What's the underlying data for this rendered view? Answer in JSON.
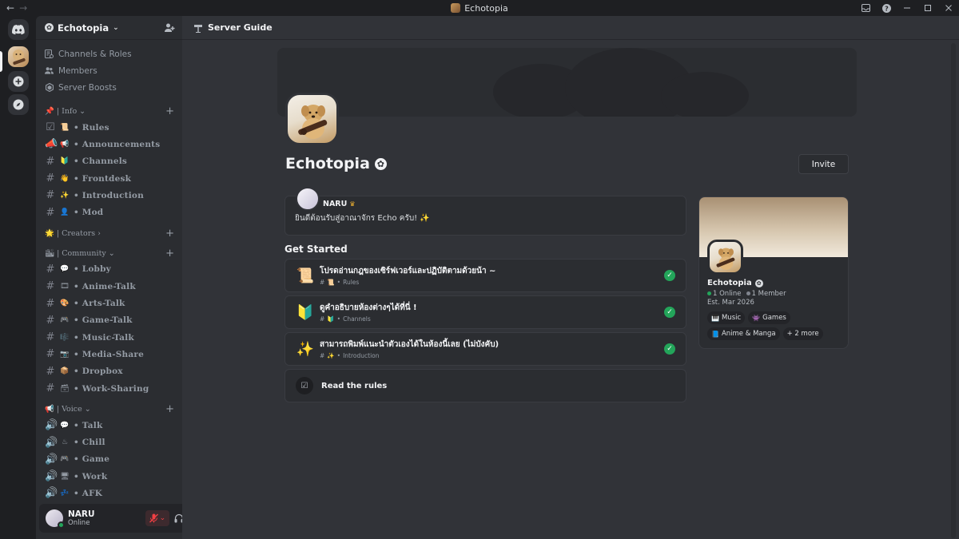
{
  "titlebar": {
    "title": "Echotopia",
    "back_icon": "←",
    "forward_icon": "→"
  },
  "sidebar": {
    "server_name": "Echotopia",
    "links": [
      {
        "label": "Channels & Roles",
        "icon": "channels-icon"
      },
      {
        "label": "Members",
        "icon": "members-icon"
      },
      {
        "label": "Server Boosts",
        "icon": "boost-icon"
      }
    ],
    "categories": [
      {
        "label": "| Info",
        "emoji": "📌",
        "expanded": true,
        "channels": [
          {
            "name": "• Rules",
            "emoji": "📜",
            "type": "rules"
          },
          {
            "name": "• Announcements",
            "emoji": "📢",
            "type": "announcement"
          },
          {
            "name": "• Channels",
            "emoji": "🔰",
            "type": "text"
          },
          {
            "name": "• Frontdesk",
            "emoji": "👋",
            "type": "text"
          },
          {
            "name": "• Introduction",
            "emoji": "✨",
            "type": "text"
          },
          {
            "name": "• Mod",
            "emoji": "👤",
            "type": "text"
          }
        ]
      },
      {
        "label": "| Creators",
        "emoji": "🌟",
        "expanded": false,
        "channels": []
      },
      {
        "label": "| Community",
        "emoji": "🏙",
        "expanded": true,
        "channels": [
          {
            "name": "• Lobby",
            "emoji": "💬",
            "type": "text"
          },
          {
            "name": "• Anime-Talk",
            "emoji": "🎞",
            "type": "text"
          },
          {
            "name": "• Arts-Talk",
            "emoji": "🎨",
            "type": "text"
          },
          {
            "name": "• Game-Talk",
            "emoji": "🎮",
            "type": "text"
          },
          {
            "name": "• Music-Talk",
            "emoji": "🎼",
            "type": "text"
          },
          {
            "name": "• Media-Share",
            "emoji": "📷",
            "type": "text"
          },
          {
            "name": "• Dropbox",
            "emoji": "📦",
            "type": "text"
          },
          {
            "name": "• Work-Sharing",
            "emoji": "🗃",
            "type": "text"
          }
        ]
      },
      {
        "label": "| Voice",
        "emoji": "📢",
        "expanded": true,
        "channels": [
          {
            "name": "• Talk",
            "emoji": "💬",
            "type": "voice"
          },
          {
            "name": "• Chill",
            "emoji": "♨",
            "type": "voice"
          },
          {
            "name": "• Game",
            "emoji": "🎮",
            "type": "voice"
          },
          {
            "name": "• Work",
            "emoji": "🖥",
            "type": "voice"
          },
          {
            "name": "• AFK",
            "emoji": "💤",
            "type": "voice"
          }
        ]
      }
    ]
  },
  "user": {
    "name": "NARU",
    "status": "Online"
  },
  "main": {
    "header_title": "Server Guide",
    "server_name": "Echotopia",
    "invite_label": "Invite",
    "welcome": {
      "author": "NARU",
      "text": "ยินดีต้อนรับสู่อาณาจักร Echo ครับ! ✨"
    },
    "get_started_title": "Get Started",
    "tasks": [
      {
        "emoji": "📜",
        "title": "โปรดอ่านกฎของเซิร์ฟเวอร์และปฏิบัติตามด้วยน้า ~",
        "channel_emoji": "📜",
        "channel": "Rules",
        "done": true
      },
      {
        "emoji": "🔰",
        "title": "ดูคำอธิบายห้องต่างๆได้ที่นี่ !",
        "channel_emoji": "🔰",
        "channel": "Channels",
        "done": true
      },
      {
        "emoji": "✨",
        "title": "สามารถพิมพ์แนะนำตัวเองได้ในห้องนี้เลย (ไม่บังคับ)",
        "channel_emoji": "✨",
        "channel": "Introduction",
        "done": true
      }
    ],
    "read_rules_label": "Read the rules"
  },
  "card": {
    "name": "Echotopia",
    "online": "1 Online",
    "members": "1 Member",
    "established": "Est. Mar 2026",
    "tags": [
      {
        "icon": "🎹",
        "label": "Music"
      },
      {
        "icon": "👾",
        "label": "Games"
      },
      {
        "icon": "📘",
        "label": "Anime & Manga"
      },
      {
        "icon": "",
        "label": "+ 2 more"
      }
    ]
  },
  "colors": {
    "online": "#23a55a",
    "muted": "#f23f43",
    "accent": "#5865f2"
  }
}
